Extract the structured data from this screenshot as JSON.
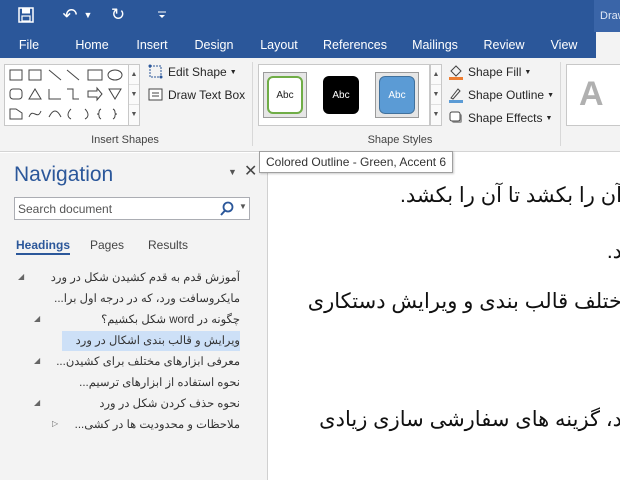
{
  "qat": {
    "context_tab_label": "Draw"
  },
  "tabs": [
    "File",
    "Home",
    "Insert",
    "Design",
    "Layout",
    "References",
    "Mailings",
    "Review",
    "View"
  ],
  "ribbon": {
    "insert_shapes": {
      "label": "Insert Shapes",
      "edit_shape": "Edit Shape",
      "draw_text_box": "Draw Text Box"
    },
    "shape_styles": {
      "label": "Shape Styles",
      "swatches": [
        "Abc",
        "Abc",
        "Abc"
      ],
      "shape_fill": "Shape Fill",
      "shape_outline": "Shape Outline",
      "shape_effects": "Shape Effects"
    },
    "wordart_letter": "A"
  },
  "tooltip": "Colored Outline - Green, Accent 6",
  "navigation": {
    "title": "Navigation",
    "search_placeholder": "Search document",
    "tabs": [
      "Headings",
      "Pages",
      "Results"
    ],
    "headings": [
      "آموزش قدم به قدم کشیدن شکل در ورد",
      "مایکروسافت ورد، که در درجه اول برا...",
      "چگونه در word شکل بکشیم؟",
      "ویرایش و قالب بندی اشکال در ورد",
      "معرفی ابزارهای مختلف برای کشیدن...",
      "نحوه استفاده از ابزارهای ترسیم...",
      "نحوه حذف کردن شکل در ورد",
      "ملاحظات و محدودیت ها در کشی..."
    ]
  },
  "document": {
    "lines": [
      "آن را بکشد تا آن را بکشد.",
      "د.",
      "ختلف قالب بندی و ویرایش دستکاری",
      "د، گزینه های سفارشی سازی زیادی"
    ]
  },
  "colors": {
    "brand": "#2b579a",
    "swatch_outline_green": "#70ad47",
    "swatch_black": "#000000",
    "swatch_blue": "#5b9bd5"
  }
}
